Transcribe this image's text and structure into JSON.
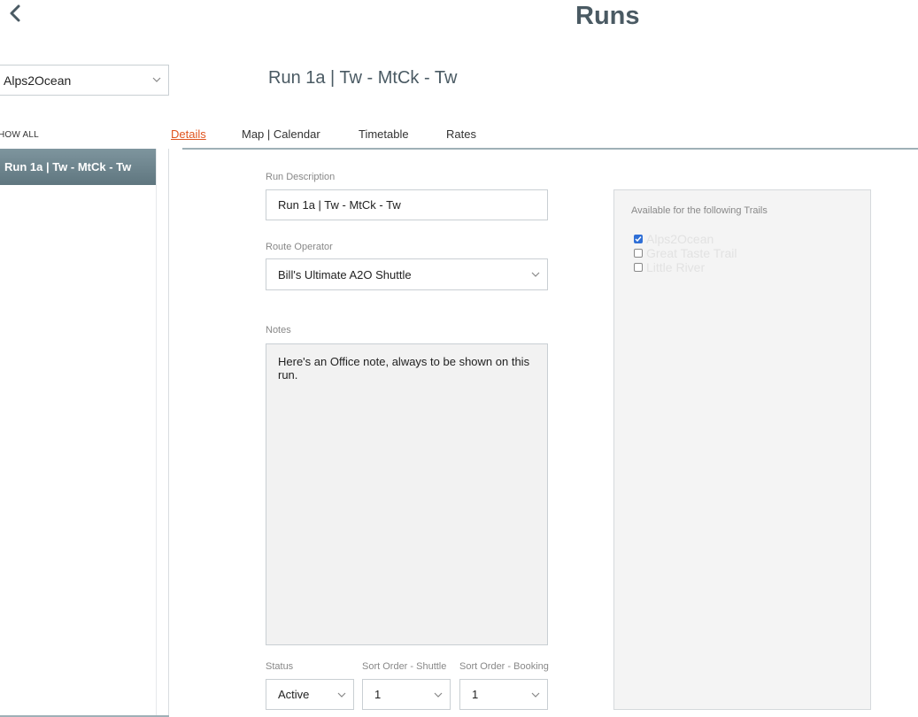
{
  "header": {
    "title": "Runs",
    "back_icon": "chevron-left-icon"
  },
  "trail_filter": {
    "selected": "Alps2Ocean"
  },
  "run_heading": "Run 1a | Tw - MtCk - Tw",
  "sidebar": {
    "show_all_label": "HOW ALL",
    "items": [
      {
        "label": "Run 1a | Tw - MtCk - Tw",
        "selected": true
      }
    ]
  },
  "tabs": [
    {
      "label": "Details",
      "active": true
    },
    {
      "label": "Map | Calendar",
      "active": false
    },
    {
      "label": "Timetable",
      "active": false
    },
    {
      "label": "Rates",
      "active": false
    }
  ],
  "form": {
    "run_description_label": "Run Description",
    "run_description_value": "Run 1a | Tw - MtCk - Tw",
    "route_operator_label": "Route Operator",
    "route_operator_value": "Bill's Ultimate A2O Shuttle",
    "notes_label": "Notes",
    "notes_value": "Here's an Office note, always to be shown on this run.",
    "status_label": "Status",
    "status_value": "Active",
    "sort_shuttle_label": "Sort Order - Shuttle",
    "sort_shuttle_value": "1",
    "sort_booking_label": "Sort Order - Booking",
    "sort_booking_value": "1"
  },
  "trails_panel": {
    "title": "Available for the following Trails",
    "trails": [
      {
        "label": "Alps2Ocean",
        "checked": true
      },
      {
        "label": "Great Taste Trail",
        "checked": false
      },
      {
        "label": "Little River",
        "checked": false
      }
    ]
  },
  "colors": {
    "accent": "#e0541e",
    "title": "#4a5a63",
    "sidebar_selected": "#6b828b",
    "checkbox_checked": "#2f6fd6"
  }
}
